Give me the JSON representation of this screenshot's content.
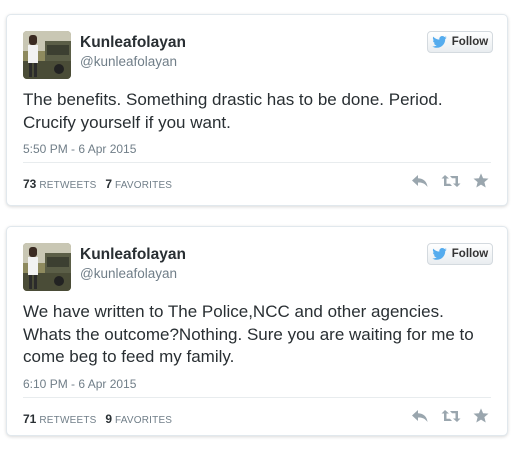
{
  "tweets": [
    {
      "display_name": "Kunleafolayan",
      "handle": "@kunleafolayan",
      "follow_label": "Follow",
      "text": "The benefits. Something drastic has to be done. Period. Crucify yourself if you want.",
      "timestamp": "5:50 PM - 6 Apr 2015",
      "retweets": "73",
      "retweets_label": "RETWEETS",
      "favorites": "7",
      "favorites_label": "FAVORITES"
    },
    {
      "display_name": "Kunleafolayan",
      "handle": "@kunleafolayan",
      "follow_label": "Follow",
      "text": "We have written to The Police,NCC and other agencies. Whats the outcome?Nothing. Sure you are waiting for me to come beg to feed my family.",
      "timestamp": "6:10 PM - 6 Apr 2015",
      "retweets": "71",
      "retweets_label": "RETWEETS",
      "favorites": "9",
      "favorites_label": "FAVORITES"
    }
  ],
  "icons": {
    "follow": "twitter-bird-icon",
    "reply": "reply-icon",
    "retweet": "retweet-icon",
    "favorite": "star-icon"
  },
  "colors": {
    "twitter_blue": "#55acee",
    "text": "#292f33",
    "muted": "#707e88",
    "action_icon": "#9aa6ae",
    "border": "#e1e8ed"
  }
}
